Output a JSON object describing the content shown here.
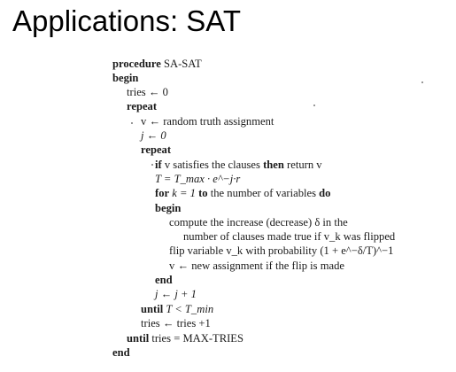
{
  "title": "Applications: SAT",
  "algorithm": {
    "l1_kw": "procedure",
    "l1_rest": "SA-SAT",
    "l2_kw": "begin",
    "l3": "tries ← 0",
    "l4_kw": "repeat",
    "l5": "v ← random truth assignment",
    "l6": "j ← 0",
    "l7_kw": "repeat",
    "l8_kw1": "if",
    "l8_mid": "v satisfies the clauses",
    "l8_kw2": "then",
    "l8_rest": "return v",
    "l9": "T = T_max · e^−j·r",
    "l10_kw1": "for",
    "l10_mid": "k = 1",
    "l10_kw2": "to",
    "l10_rest": "the number of variables",
    "l10_kw3": "do",
    "l11_kw": "begin",
    "l12": "compute the increase (decrease) δ in the",
    "l13": "number of clauses made true if v_k was flipped",
    "l14": "flip variable v_k with probability (1 + e^−δ/T)^−1",
    "l15": "v ← new assignment if the flip is made",
    "l16_kw": "end",
    "l17": "j ← j + 1",
    "l18_kw": "until",
    "l18_rest": "T < T_min",
    "l19": "tries ← tries +1",
    "l20_kw": "until",
    "l20_rest": "tries = MAX-TRIES",
    "l21_kw": "end"
  }
}
